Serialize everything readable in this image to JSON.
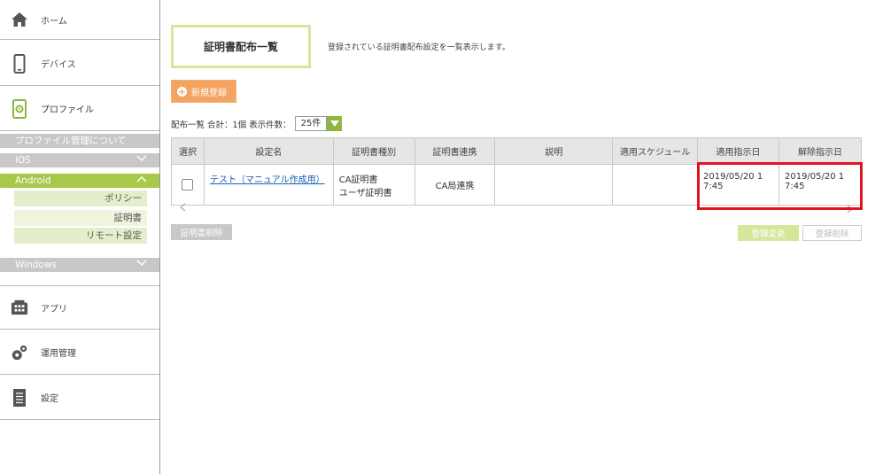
{
  "sidebar": {
    "home": "ホーム",
    "device": "デバイス",
    "profile": "プロファイル",
    "about": "プロファイル管理について",
    "ios": "iOS",
    "android": "Android",
    "android_children": [
      "ポリシー",
      "証明書",
      "リモート設定"
    ],
    "windows": "Windows",
    "apps": "アプリ",
    "ops": "運用管理",
    "settings": "設定"
  },
  "page": {
    "title": "証明書配布一覧",
    "description": "登録されている証明書配布設定を一覧表示します。",
    "new_button": "新規登録",
    "count_text": "配布一覧 合計：1個 表示件数：",
    "per_page": "25件"
  },
  "table": {
    "headers": [
      "選択",
      "設定名",
      "証明書種別",
      "証明書連携",
      "説明",
      "適用スケジュール",
      "適用指示日",
      "解除指示日"
    ],
    "rows": [
      {
        "name": "テスト（マニュアル作成用）",
        "type_line1": "CA証明書",
        "type_line2": "ユーザ証明書",
        "link": "CA局連携",
        "desc": "",
        "schedule": "",
        "apply_line1": "2019/05/20 1",
        "apply_line2": "7:45",
        "release_line1": "2019/05/20 1",
        "release_line2": "7:45"
      }
    ]
  },
  "actions": {
    "delete": "証明書削除",
    "change": "登録変更",
    "remove": "登録削除"
  },
  "colors": {
    "accent_green": "#a8c84a",
    "orange": "#f4a460",
    "highlight_red": "#e0141e"
  }
}
